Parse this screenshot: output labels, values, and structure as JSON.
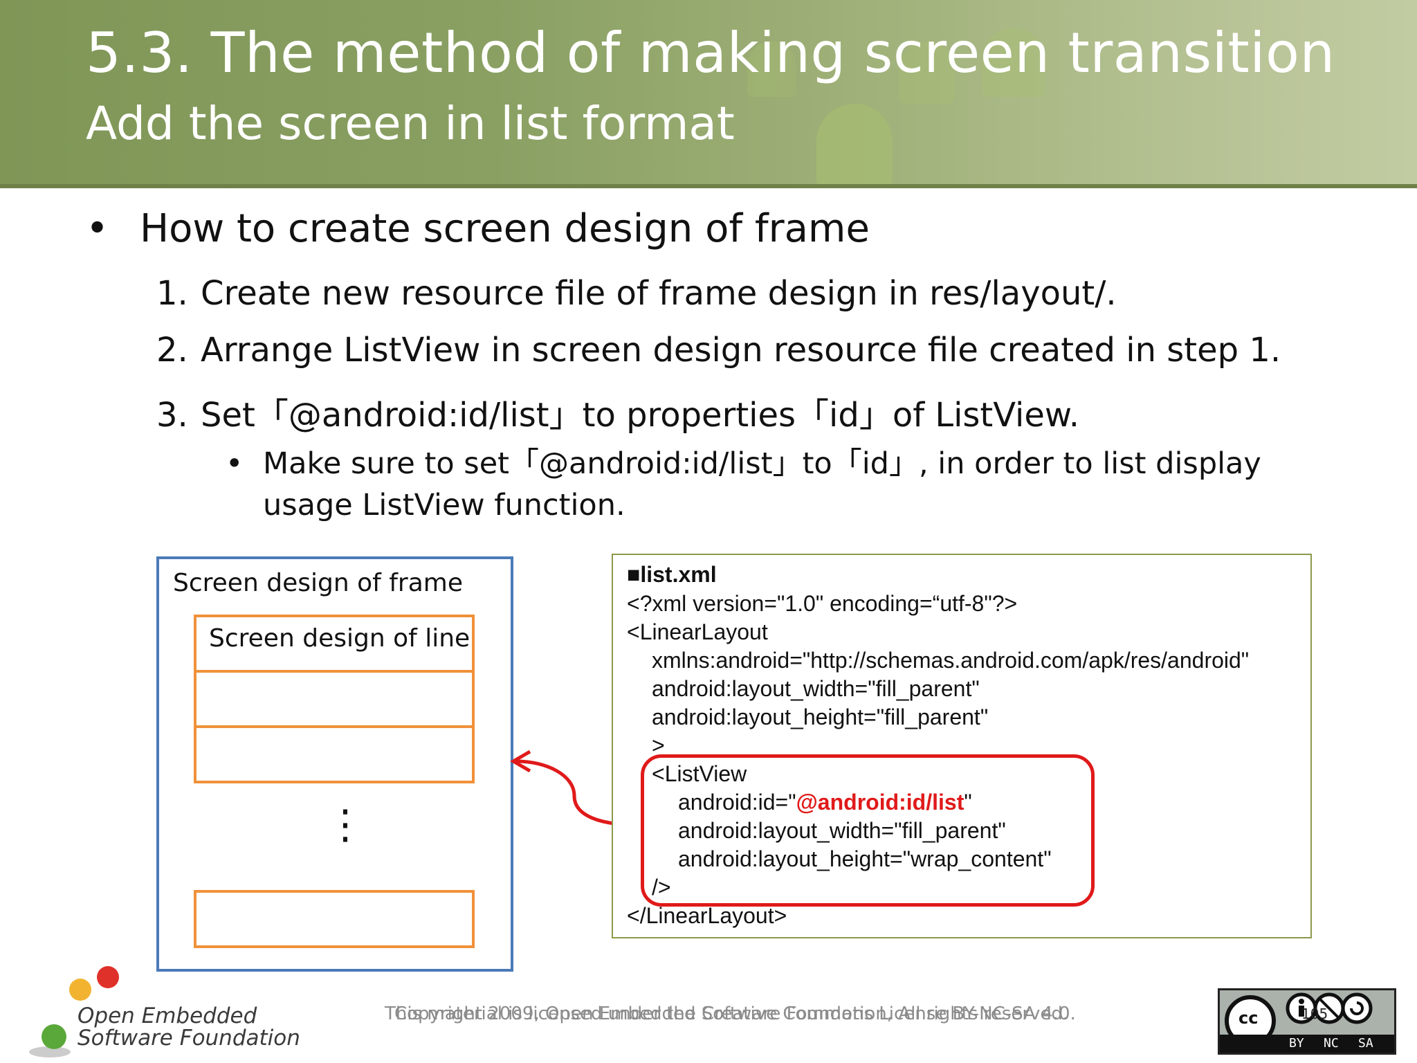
{
  "header": {
    "title": "5.3. The method of making screen transition",
    "subtitle": "Add the screen in list format"
  },
  "content": {
    "main_bullet": "How to create screen design of frame",
    "bullet_symbol": "•",
    "steps": [
      {
        "num": "1.",
        "text": "Create new resource file of frame design in res/layout/."
      },
      {
        "num": "2.",
        "text": "Arrange ListView in screen design resource file created in step 1."
      },
      {
        "num": "3.",
        "text": "Set「@android:id/list」to properties「id」of ListView."
      }
    ],
    "sub_bullet": "Make sure to set「@android:id/list」to「id」, in order to list display usage ListView function."
  },
  "diagram": {
    "frame_label": "Screen design of frame",
    "line_label": "Screen design of line",
    "ellipsis": "⋮"
  },
  "code": {
    "filename": "■list.xml",
    "lines": [
      "<?xml version=\"1.0\" encoding=“utf-8\"?>",
      "<LinearLayout",
      "xmlns:android=\"http://schemas.android.com/apk/res/android\"",
      "android:layout_width=\"fill_parent\"",
      "android:layout_height=\"fill_parent\"",
      ">",
      "<ListView",
      "android:id=\"",
      "@android:id/list",
      "\"",
      "android:layout_width=\"fill_parent\"",
      "android:layout_height=\"wrap_content\"",
      "/>",
      "</LinearLayout>"
    ]
  },
  "footer": {
    "copyright": "This material is licensed under the Creative Commons License BY-NC-SA 4.0.",
    "copyright2": "Copyright 2009, Open Embedded Software Foundation, All rights reserved.",
    "logo_line1": "Open Embedded",
    "logo_line2": "Software Foundation",
    "page_number": "105",
    "license_badge": {
      "cc": "cc",
      "by": "BY",
      "nc": "NC",
      "sa": "SA"
    }
  },
  "colors": {
    "header_green": "#8aa063",
    "frame_blue": "#4a7ab8",
    "row_orange": "#f0913a",
    "highlight_red": "#e01a1a",
    "code_border": "#8a9a4a"
  }
}
